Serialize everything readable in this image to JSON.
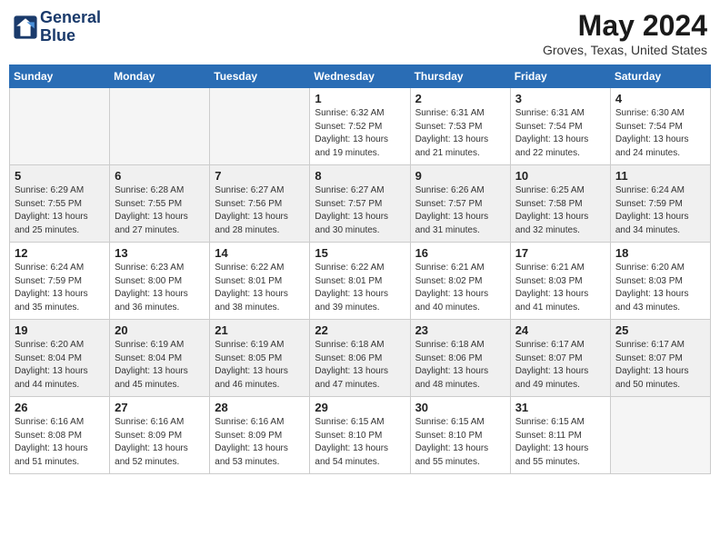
{
  "header": {
    "logo_line1": "General",
    "logo_line2": "Blue",
    "month_year": "May 2024",
    "location": "Groves, Texas, United States"
  },
  "days_of_week": [
    "Sunday",
    "Monday",
    "Tuesday",
    "Wednesday",
    "Thursday",
    "Friday",
    "Saturday"
  ],
  "weeks": [
    {
      "row_class": "week-row-light",
      "days": [
        {
          "num": "",
          "info": ""
        },
        {
          "num": "",
          "info": ""
        },
        {
          "num": "",
          "info": ""
        },
        {
          "num": "1",
          "info": "Sunrise: 6:32 AM\nSunset: 7:52 PM\nDaylight: 13 hours\nand 19 minutes."
        },
        {
          "num": "2",
          "info": "Sunrise: 6:31 AM\nSunset: 7:53 PM\nDaylight: 13 hours\nand 21 minutes."
        },
        {
          "num": "3",
          "info": "Sunrise: 6:31 AM\nSunset: 7:54 PM\nDaylight: 13 hours\nand 22 minutes."
        },
        {
          "num": "4",
          "info": "Sunrise: 6:30 AM\nSunset: 7:54 PM\nDaylight: 13 hours\nand 24 minutes."
        }
      ]
    },
    {
      "row_class": "week-row-dark",
      "days": [
        {
          "num": "5",
          "info": "Sunrise: 6:29 AM\nSunset: 7:55 PM\nDaylight: 13 hours\nand 25 minutes."
        },
        {
          "num": "6",
          "info": "Sunrise: 6:28 AM\nSunset: 7:55 PM\nDaylight: 13 hours\nand 27 minutes."
        },
        {
          "num": "7",
          "info": "Sunrise: 6:27 AM\nSunset: 7:56 PM\nDaylight: 13 hours\nand 28 minutes."
        },
        {
          "num": "8",
          "info": "Sunrise: 6:27 AM\nSunset: 7:57 PM\nDaylight: 13 hours\nand 30 minutes."
        },
        {
          "num": "9",
          "info": "Sunrise: 6:26 AM\nSunset: 7:57 PM\nDaylight: 13 hours\nand 31 minutes."
        },
        {
          "num": "10",
          "info": "Sunrise: 6:25 AM\nSunset: 7:58 PM\nDaylight: 13 hours\nand 32 minutes."
        },
        {
          "num": "11",
          "info": "Sunrise: 6:24 AM\nSunset: 7:59 PM\nDaylight: 13 hours\nand 34 minutes."
        }
      ]
    },
    {
      "row_class": "week-row-light",
      "days": [
        {
          "num": "12",
          "info": "Sunrise: 6:24 AM\nSunset: 7:59 PM\nDaylight: 13 hours\nand 35 minutes."
        },
        {
          "num": "13",
          "info": "Sunrise: 6:23 AM\nSunset: 8:00 PM\nDaylight: 13 hours\nand 36 minutes."
        },
        {
          "num": "14",
          "info": "Sunrise: 6:22 AM\nSunset: 8:01 PM\nDaylight: 13 hours\nand 38 minutes."
        },
        {
          "num": "15",
          "info": "Sunrise: 6:22 AM\nSunset: 8:01 PM\nDaylight: 13 hours\nand 39 minutes."
        },
        {
          "num": "16",
          "info": "Sunrise: 6:21 AM\nSunset: 8:02 PM\nDaylight: 13 hours\nand 40 minutes."
        },
        {
          "num": "17",
          "info": "Sunrise: 6:21 AM\nSunset: 8:03 PM\nDaylight: 13 hours\nand 41 minutes."
        },
        {
          "num": "18",
          "info": "Sunrise: 6:20 AM\nSunset: 8:03 PM\nDaylight: 13 hours\nand 43 minutes."
        }
      ]
    },
    {
      "row_class": "week-row-dark",
      "days": [
        {
          "num": "19",
          "info": "Sunrise: 6:20 AM\nSunset: 8:04 PM\nDaylight: 13 hours\nand 44 minutes."
        },
        {
          "num": "20",
          "info": "Sunrise: 6:19 AM\nSunset: 8:04 PM\nDaylight: 13 hours\nand 45 minutes."
        },
        {
          "num": "21",
          "info": "Sunrise: 6:19 AM\nSunset: 8:05 PM\nDaylight: 13 hours\nand 46 minutes."
        },
        {
          "num": "22",
          "info": "Sunrise: 6:18 AM\nSunset: 8:06 PM\nDaylight: 13 hours\nand 47 minutes."
        },
        {
          "num": "23",
          "info": "Sunrise: 6:18 AM\nSunset: 8:06 PM\nDaylight: 13 hours\nand 48 minutes."
        },
        {
          "num": "24",
          "info": "Sunrise: 6:17 AM\nSunset: 8:07 PM\nDaylight: 13 hours\nand 49 minutes."
        },
        {
          "num": "25",
          "info": "Sunrise: 6:17 AM\nSunset: 8:07 PM\nDaylight: 13 hours\nand 50 minutes."
        }
      ]
    },
    {
      "row_class": "week-row-light",
      "days": [
        {
          "num": "26",
          "info": "Sunrise: 6:16 AM\nSunset: 8:08 PM\nDaylight: 13 hours\nand 51 minutes."
        },
        {
          "num": "27",
          "info": "Sunrise: 6:16 AM\nSunset: 8:09 PM\nDaylight: 13 hours\nand 52 minutes."
        },
        {
          "num": "28",
          "info": "Sunrise: 6:16 AM\nSunset: 8:09 PM\nDaylight: 13 hours\nand 53 minutes."
        },
        {
          "num": "29",
          "info": "Sunrise: 6:15 AM\nSunset: 8:10 PM\nDaylight: 13 hours\nand 54 minutes."
        },
        {
          "num": "30",
          "info": "Sunrise: 6:15 AM\nSunset: 8:10 PM\nDaylight: 13 hours\nand 55 minutes."
        },
        {
          "num": "31",
          "info": "Sunrise: 6:15 AM\nSunset: 8:11 PM\nDaylight: 13 hours\nand 55 minutes."
        },
        {
          "num": "",
          "info": ""
        }
      ]
    }
  ]
}
